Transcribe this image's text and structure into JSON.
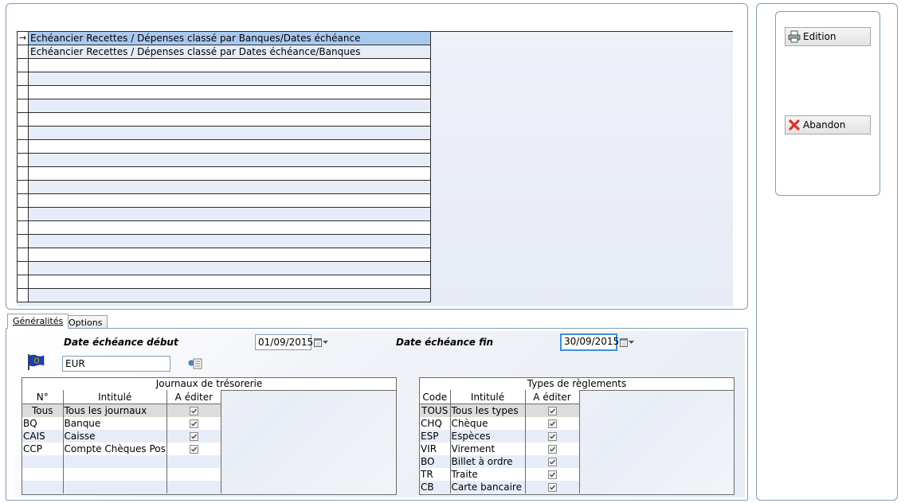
{
  "reports": {
    "items": [
      {
        "label": "Echéancier Recettes / Dépenses classé par Banques/Dates échéance",
        "selected": true
      },
      {
        "label": "Echéancier Recettes / Dépenses classé par Dates échéance/Banques",
        "selected": false
      }
    ],
    "empty_rows": 18,
    "selected_marker": "→"
  },
  "actions": {
    "edition_label": "Edition",
    "abandon_label": "Abandon"
  },
  "tabs": {
    "generalites": "Généralités",
    "options": "Options"
  },
  "filters": {
    "date_debut_label": "Date échéance début",
    "date_debut_value": "01/09/2015",
    "date_fin_label": "Date échéance fin",
    "date_fin_value": "30/09/2015",
    "currency_value": "EUR"
  },
  "journaux": {
    "caption": "Journaux de trésorerie",
    "headers": [
      "N°",
      "Intitulé",
      "A éditer"
    ],
    "rows": [
      {
        "code": "Tous",
        "label": "Tous les journaux",
        "checked": true
      },
      {
        "code": "BQ",
        "label": "Banque",
        "checked": true
      },
      {
        "code": "CAIS",
        "label": "Caisse",
        "checked": true
      },
      {
        "code": "CCP",
        "label": "Compte Chèques Pos",
        "checked": true
      }
    ],
    "empty_rows": 3
  },
  "reglements": {
    "caption": "Types de règlements",
    "headers": [
      "Code",
      "Intitulé",
      "A éditer"
    ],
    "rows": [
      {
        "code": "TOUS",
        "label": "Tous les types",
        "checked": true
      },
      {
        "code": "CHQ",
        "label": "Chèque",
        "checked": true
      },
      {
        "code": "ESP",
        "label": "Espèces",
        "checked": true
      },
      {
        "code": "VIR",
        "label": "Virement",
        "checked": true
      },
      {
        "code": "BO",
        "label": "Billet à ordre",
        "checked": true
      },
      {
        "code": "TR",
        "label": "Traite",
        "checked": true
      },
      {
        "code": "CB",
        "label": "Carte bancaire",
        "checked": true
      }
    ],
    "empty_rows": 0
  },
  "colors": {
    "panel_border": "#7f9db9",
    "selection": "#a9c8ef",
    "alt_row": "#e6edf8",
    "focus_border": "#3b8fd6",
    "abandon_icon": "#d9342b",
    "flag_blue": "#1b3fb0"
  }
}
